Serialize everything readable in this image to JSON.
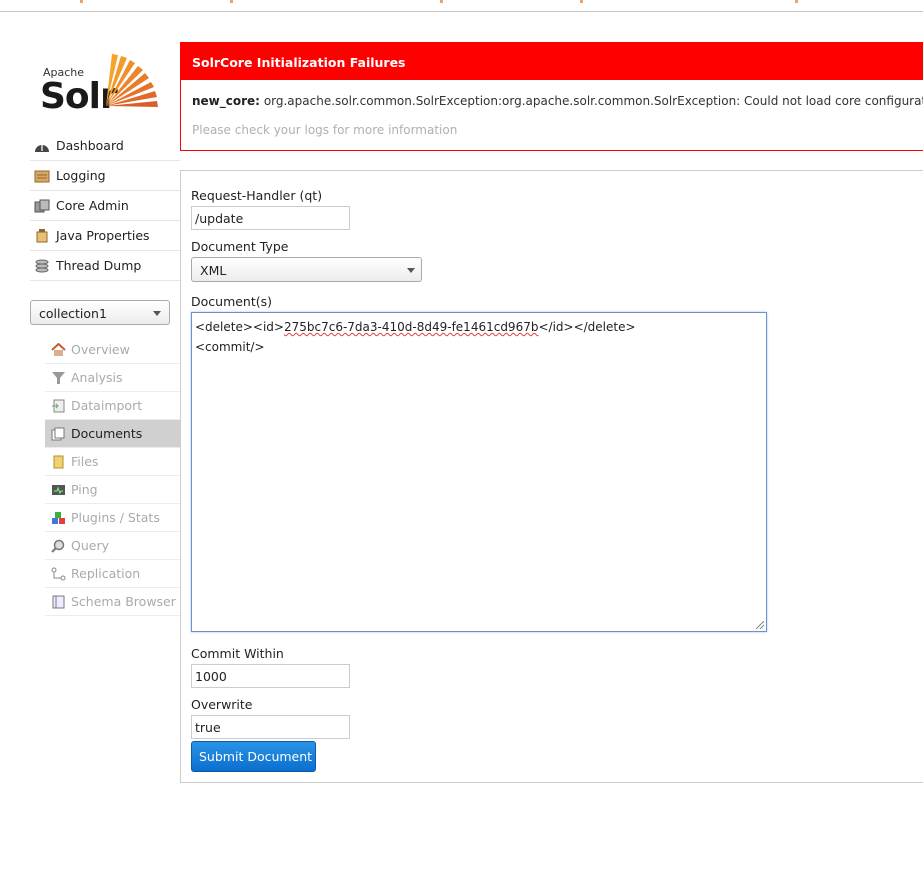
{
  "logo": {
    "apache": "Apache",
    "solr": "Solr"
  },
  "nav": [
    {
      "label": "Dashboard",
      "icon": "dashboard-icon"
    },
    {
      "label": "Logging",
      "icon": "logging-icon"
    },
    {
      "label": "Core Admin",
      "icon": "core-admin-icon"
    },
    {
      "label": "Java Properties",
      "icon": "java-properties-icon"
    },
    {
      "label": "Thread Dump",
      "icon": "thread-dump-icon"
    }
  ],
  "core_selector": {
    "value": "collection1"
  },
  "core_nav": [
    {
      "label": "Overview",
      "icon": "overview-icon",
      "active": false
    },
    {
      "label": "Analysis",
      "icon": "analysis-icon",
      "active": false
    },
    {
      "label": "Dataimport",
      "icon": "dataimport-icon",
      "active": false
    },
    {
      "label": "Documents",
      "icon": "documents-icon",
      "active": true
    },
    {
      "label": "Files",
      "icon": "files-icon",
      "active": false
    },
    {
      "label": "Ping",
      "icon": "ping-icon",
      "active": false
    },
    {
      "label": "Plugins / Stats",
      "icon": "plugins-icon",
      "active": false
    },
    {
      "label": "Query",
      "icon": "query-icon",
      "active": false
    },
    {
      "label": "Replication",
      "icon": "replication-icon",
      "active": false
    },
    {
      "label": "Schema Browser",
      "icon": "schema-browser-icon",
      "active": false
    }
  ],
  "error": {
    "title": "SolrCore Initialization Failures",
    "core": "new_core:",
    "message": "org.apache.solr.common.SolrException:org.apache.solr.common.SolrException: Could not load core configurati",
    "hint": "Please check your logs for more information"
  },
  "form": {
    "request_handler_label": "Request-Handler (qt)",
    "request_handler_value": "/update",
    "document_type_label": "Document Type",
    "document_type_value": "XML",
    "documents_label": "Document(s)",
    "documents_line1_pre": "<delete><id>",
    "documents_line1_id": "275bc7c6-7da3-410d-8d49-fe1461cd967b",
    "documents_line1_post": "</id></delete>",
    "documents_line2": "<commit/>",
    "commit_within_label": "Commit Within",
    "commit_within_value": "1000",
    "overwrite_label": "Overwrite",
    "overwrite_value": "true",
    "submit_label": "Submit Document"
  },
  "colors": {
    "error_red": "#ff0000",
    "submit_blue": "#0b6fcf",
    "active_nav": "#d0d0d0"
  }
}
